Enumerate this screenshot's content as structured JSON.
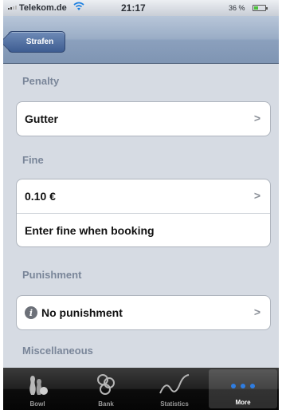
{
  "status_bar": {
    "carrier": "Telekom.de",
    "time": "21:17",
    "battery_percent": "36 %",
    "battery_level": 0.36
  },
  "nav_bar": {
    "back_label": "Strafen"
  },
  "sections": [
    {
      "header": "Penalty",
      "rows": [
        {
          "label": "Gutter"
        }
      ]
    },
    {
      "header": "Fine",
      "rows": [
        {
          "label": "0.10 €"
        },
        {
          "label": "Enter fine when booking"
        }
      ]
    },
    {
      "header": "Punishment",
      "rows": [
        {
          "label": "No punishment"
        }
      ]
    },
    {
      "header": "Miscellaneous",
      "rows": []
    }
  ],
  "tab_bar": {
    "items": [
      {
        "label": "Bowl",
        "icon": "bowling-pins-icon"
      },
      {
        "label": "Bank",
        "icon": "bank-coins-icon"
      },
      {
        "label": "Statistics",
        "icon": "statistics-line-icon"
      },
      {
        "label": "More",
        "icon": "more-dots-icon",
        "active": true
      }
    ]
  },
  "colors": {
    "nav_bar": "#8ba0bd",
    "back_button": "#3e5d92",
    "background": "#d6dbe3",
    "section_header": "#7a8699",
    "tab_bar": "#0c0c0c",
    "tab_active_dots": "#2f7de1"
  }
}
